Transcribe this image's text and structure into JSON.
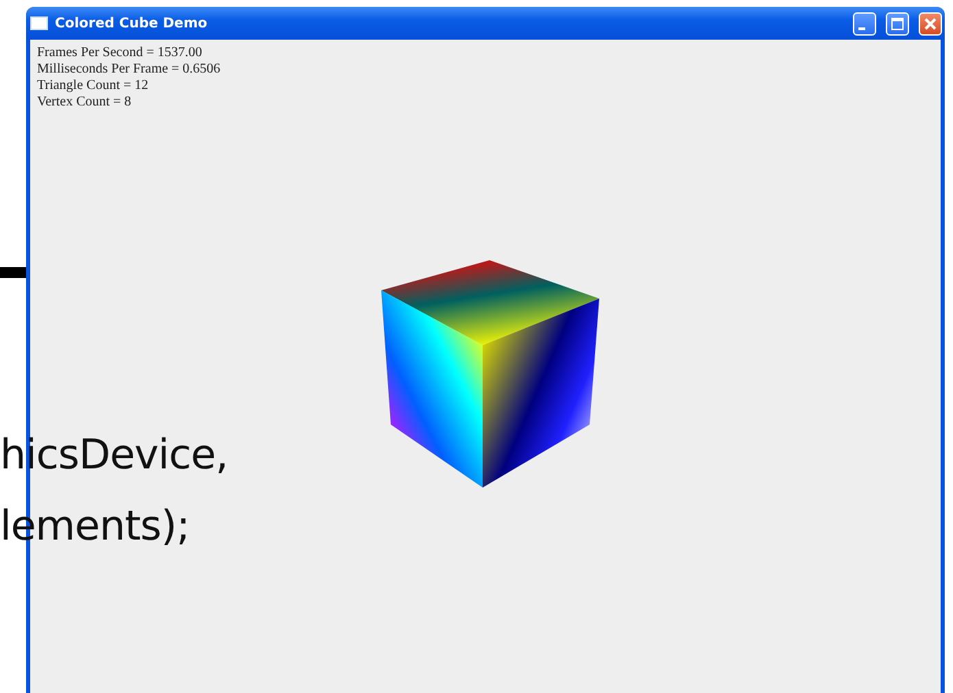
{
  "window": {
    "title": "Colored Cube Demo"
  },
  "stats": [
    "Frames Per Second = 1537.00",
    "Milliseconds Per Frame = 0.6506",
    "Triangle Count = 12",
    "Vertex Count = 8"
  ],
  "background_code": [
    "hicsDevice,",
    "lements);"
  ]
}
